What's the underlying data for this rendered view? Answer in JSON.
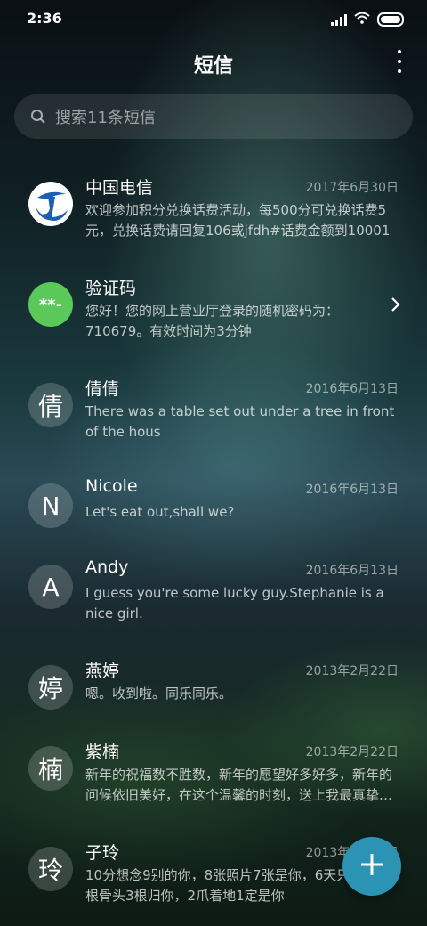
{
  "status": {
    "time": "2:36"
  },
  "header": {
    "title": "短信"
  },
  "search": {
    "placeholder": "搜索11条短信"
  },
  "colors": {
    "fab": "#2b93b3",
    "telecom_logo": "#1a5fb4",
    "code_avatar": "#5bc95a"
  },
  "conversations": [
    {
      "name": "中国电信",
      "date": "2017年6月30日",
      "preview": "欢迎参加积分兑换话费活动，每500分可兑换话费5元，兑换话费请回复106或jfdh#话费金额到10001",
      "avatar_icon": "china-telecom-logo"
    },
    {
      "name": "验证码",
      "date": "",
      "preview": "您好！您的网上营业厅登录的随机密码为：710679。有效时间为3分钟",
      "avatar_text": "**-",
      "avatar_icon": "verification-code-icon"
    },
    {
      "name": "倩倩",
      "date": "2016年6月13日",
      "preview": "There was a table set out under a tree in front of the hous",
      "avatar_text": "倩"
    },
    {
      "name": "Nicole",
      "date": "2016年6月13日",
      "preview": "Let's eat out,shall we?",
      "avatar_text": "N"
    },
    {
      "name": "Andy",
      "date": "2016年6月13日",
      "preview": "I guess you're some lucky guy.Stephanie is a nice girl.",
      "avatar_text": "A"
    },
    {
      "name": "燕婷",
      "date": "2013年2月22日",
      "preview": "嗯。收到啦。同乐同乐。",
      "avatar_text": "婷"
    },
    {
      "name": "紫楠",
      "date": "2013年2月22日",
      "preview": "新年的祝福数不胜数，新年的愿望好多好多，新年的问候依旧美好，在这个温馨的时刻，送上我最真挚的祝福",
      "avatar_text": "楠"
    },
    {
      "name": "子玲",
      "date": "2013年2月22日",
      "preview": "10分想念9别的你，8张照片7张是你，6天只像你，4根骨头3根归你，2爪着地1定是你",
      "avatar_text": "玲"
    }
  ]
}
